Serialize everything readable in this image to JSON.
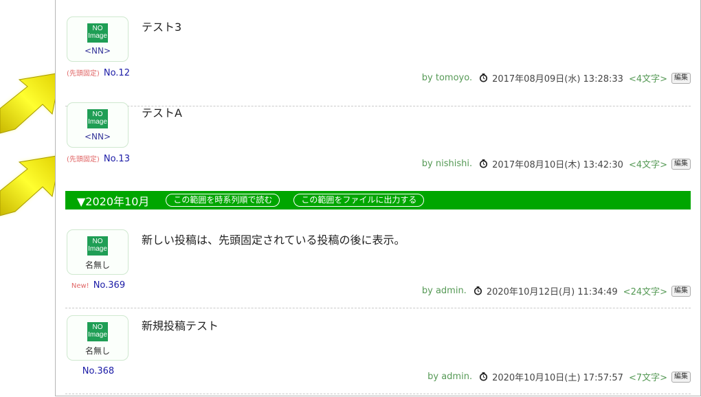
{
  "posts": [
    {
      "title": "テスト3",
      "avatar_name": "<NN>",
      "badge": "(先頭固定)",
      "number": "No.12",
      "author": "by tomoyo.",
      "date": "2017年08月09日(水) 13:28:33",
      "chars": "<4文字>",
      "edit": "編集"
    },
    {
      "title": "テストA",
      "avatar_name": "<NN>",
      "badge": "(先頭固定)",
      "number": "No.13",
      "author": "by nishishi.",
      "date": "2017年08月10日(木) 13:42:30",
      "chars": "<4文字>",
      "edit": "編集"
    },
    {
      "title": "新しい投稿は、先頭固定されている投稿の後に表示。",
      "avatar_name": "名無し",
      "badge": "New!",
      "number": "No.369",
      "author": "by admin.",
      "date": "2020年10月12日(月) 11:34:49",
      "chars": "<24文字>",
      "edit": "編集"
    },
    {
      "title": "新規投稿テスト",
      "avatar_name": "名無し",
      "badge": "",
      "number": "No.368",
      "author": "by admin.",
      "date": "2020年10月10日(土) 17:57:57",
      "chars": "<7文字>",
      "edit": "編集"
    }
  ],
  "noimage": {
    "line1": "NO",
    "line2": "Image"
  },
  "month_bar": {
    "title": "▼2020年10月",
    "read_button": "この範囲を時系列順で読む",
    "export_button": "この範囲をファイルに出力する"
  },
  "colors": {
    "month_bar": "#00a600",
    "meta": "#559955",
    "number": "#1a1aa6",
    "badge": "#e06666",
    "arrow": "#f2e600"
  },
  "icons": {
    "clock": "clock-icon",
    "arrow": "highlight-arrow"
  }
}
